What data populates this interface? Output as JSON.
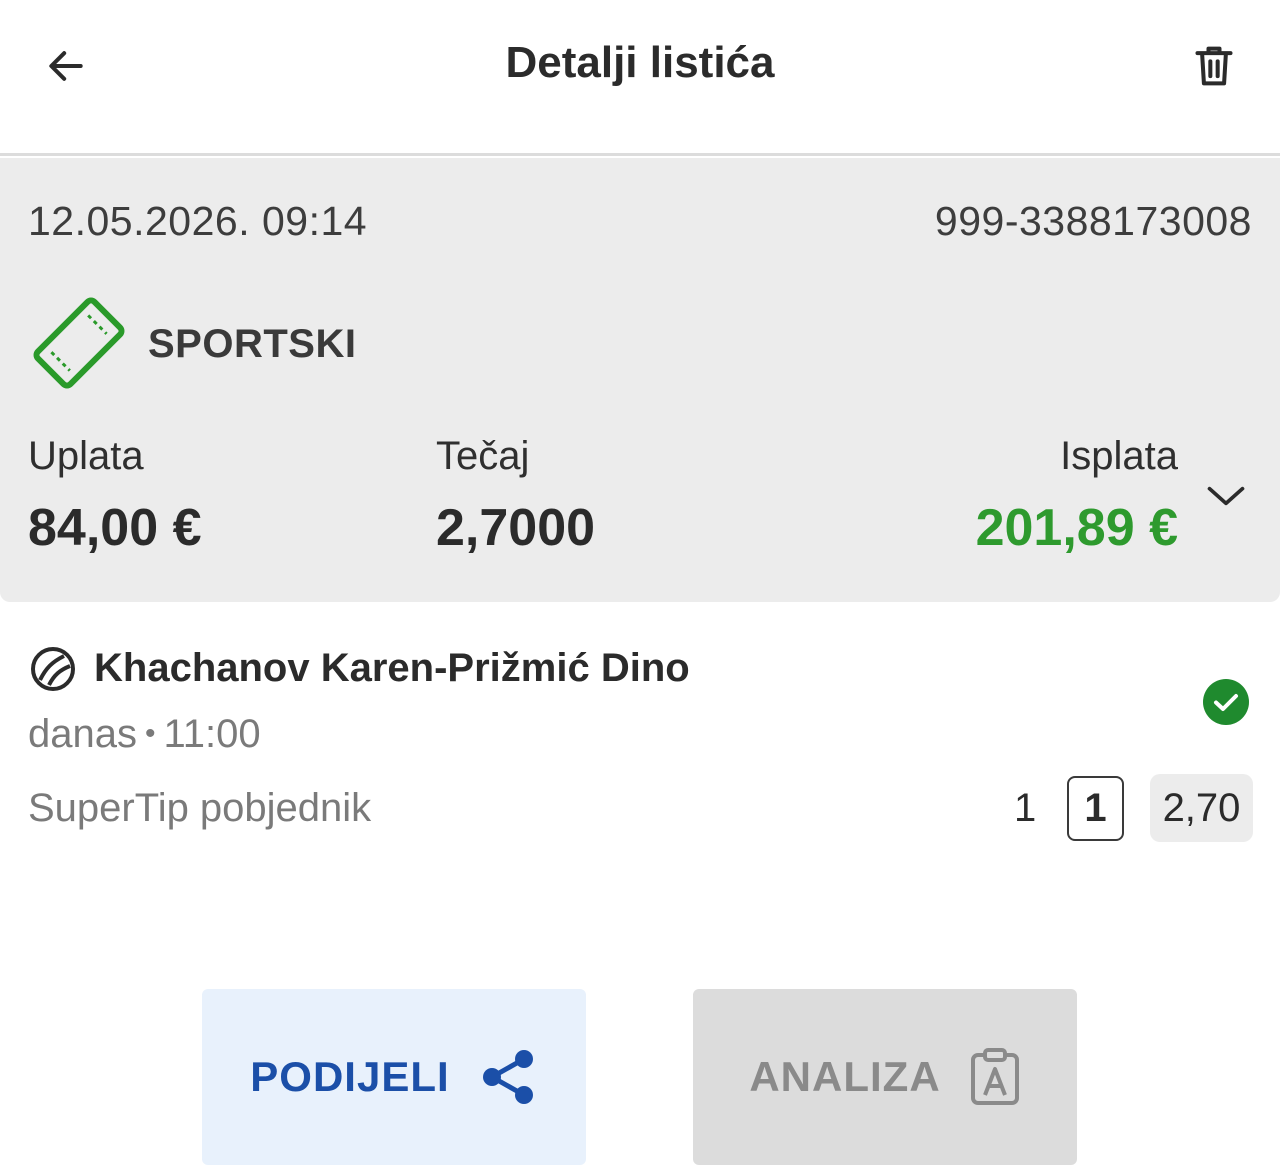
{
  "header": {
    "title": "Detalji listića",
    "back_icon": "arrow-left-icon",
    "delete_icon": "trash-icon"
  },
  "summary": {
    "datetime": "12.05.2026. 09:14",
    "ticket_id": "999-3388173008",
    "ticket_type": "SPORTSKI",
    "ticket_type_icon": "ticket-icon",
    "stake_label": "Uplata",
    "stake_value": "84,00 €",
    "odds_label": "Tečaj",
    "odds_value": "2,7000",
    "payout_label": "Isplata",
    "payout_value": "201,89 €",
    "expand_icon": "chevron-down-icon"
  },
  "event": {
    "sport_icon": "tennis-ball-icon",
    "name": "Khachanov Karen-Prižmić Dino",
    "day": "danas",
    "separator": "•",
    "time": "11:00",
    "market": "SuperTip pobjednik",
    "tip_code": "1",
    "tip_selected": "1",
    "odd": "2,70",
    "status_icon": "check-circle-icon"
  },
  "actions": {
    "share_label": "PODIJELI",
    "share_icon": "share-icon",
    "analysis_label": "ANALIZA",
    "analysis_icon": "clipboard-analysis-icon"
  },
  "colors": {
    "accent_green": "#2e9a2e",
    "ticket_icon_green": "#2a9a2a",
    "status_green": "#1f8a2e",
    "share_blue": "#1b4fa8",
    "share_bg": "#e8f1fc",
    "summary_bg": "#ececec"
  }
}
